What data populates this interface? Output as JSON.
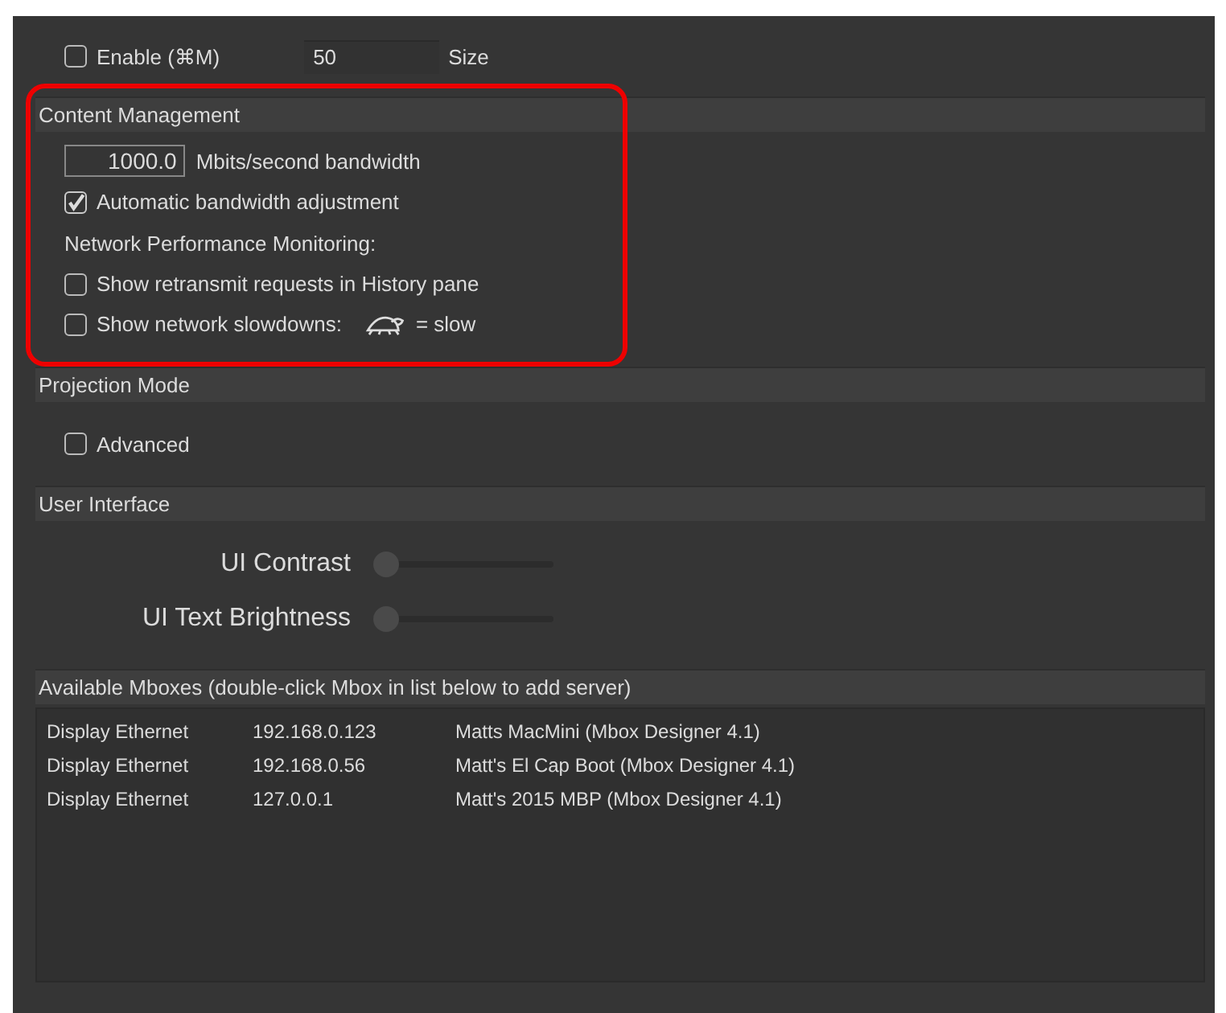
{
  "top_section": {
    "enable_checkbox": {
      "label": "Enable (⌘M)",
      "checked": false
    },
    "size_field": {
      "value": "50"
    },
    "size_label": "Size"
  },
  "content_management": {
    "title": "Content Management",
    "highlighted": true,
    "bandwidth_field": {
      "value": "1000.0"
    },
    "bandwidth_label": "Mbits/second bandwidth",
    "auto_checkbox": {
      "label": "Automatic bandwidth adjustment",
      "checked": true
    },
    "monitoring_label": "Network Performance Monitoring:",
    "retransmit_checkbox": {
      "label": "Show retransmit requests in History pane",
      "checked": false
    },
    "slowdowns_checkbox": {
      "label": "Show network slowdowns:",
      "checked": false
    },
    "slow_legend": "= slow"
  },
  "projection_mode": {
    "title": "Projection Mode",
    "advanced_checkbox": {
      "label": "Advanced",
      "checked": false
    }
  },
  "user_interface": {
    "title": "User Interface",
    "sliders": [
      {
        "label": "UI Contrast",
        "level": 0
      },
      {
        "label": "UI Text Brightness",
        "level": 0
      }
    ]
  },
  "mboxes": {
    "title": "Available Mboxes (double-click Mbox in list below to add server)",
    "rows": [
      {
        "type": "Display Ethernet",
        "address": "192.168.0.123",
        "name": "Matts MacMini (Mbox Designer 4.1)"
      },
      {
        "type": "Display Ethernet",
        "address": "192.168.0.56",
        "name": "Matt's El Cap Boot (Mbox Designer 4.1)"
      },
      {
        "type": "Display Ethernet",
        "address": "127.0.0.1",
        "name": "Matt's 2015 MBP (Mbox Designer 4.1)"
      }
    ]
  }
}
